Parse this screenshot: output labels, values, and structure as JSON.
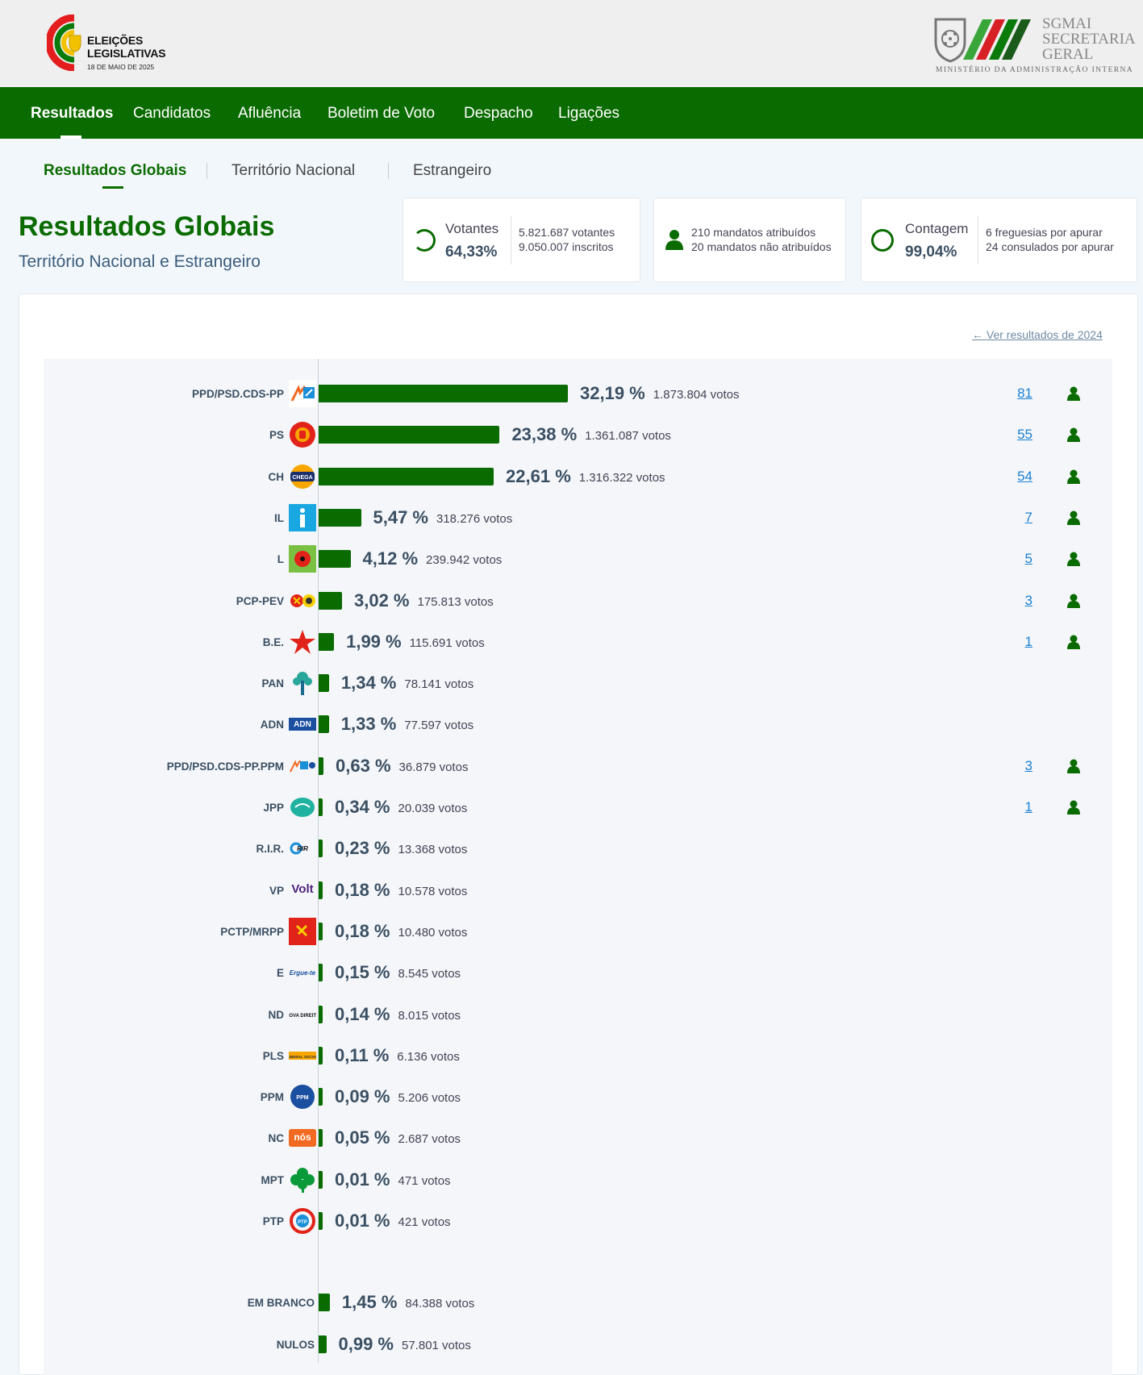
{
  "header": {
    "logo_line1": "ELEIÇÕES",
    "logo_line2": "LEGISLATIVAS",
    "logo_date": "18 DE MAIO DE 2025",
    "sgmai_line1": "SGMAI",
    "sgmai_line2": "SECRETARIA",
    "sgmai_line3": "GERAL",
    "ministry": "MINISTÉRIO DA ADMINISTRAÇÃO INTERNA"
  },
  "nav": {
    "items": [
      "Resultados",
      "Candidatos",
      "Afluência",
      "Boletim de Voto",
      "Despacho",
      "Ligações"
    ]
  },
  "subtabs": [
    "Resultados Globais",
    "Território Nacional",
    "Estrangeiro"
  ],
  "page": {
    "title": "Resultados Globais",
    "subtitle": "Território Nacional e Estrangeiro"
  },
  "stats": {
    "votantes_label": "Votantes",
    "votantes_pct": "64,33%",
    "votantes_line1": "5.821.687 votantes",
    "votantes_line2": "9.050.007 inscritos",
    "mandatos_line1": "210 mandatos atribuídos",
    "mandatos_line2": "20 mandatos não atribuídos",
    "contagem_label": "Contagem",
    "contagem_pct": "99,04%",
    "contagem_line1": "6 freguesias por apurar",
    "contagem_line2": "24 consulados por apurar"
  },
  "link_2024": "Ver resultados de 2024",
  "colors": {
    "brand_green": "#0a6b00",
    "link_blue": "#1a7fd4",
    "text_dark": "#3b4f63"
  },
  "chart_data": {
    "type": "bar",
    "orientation": "horizontal",
    "unit": "%",
    "categories": [
      "PPD/PSD.CDS-PP",
      "PS",
      "CH",
      "IL",
      "L",
      "PCP-PEV",
      "B.E.",
      "PAN",
      "ADN",
      "PPD/PSD.CDS-PP.PPM",
      "JPP",
      "R.I.R.",
      "VP",
      "PCTP/MRPP",
      "E",
      "ND",
      "PLS",
      "PPM",
      "NC",
      "MPT",
      "PTP",
      "EM BRANCO",
      "NULOS"
    ],
    "values": [
      32.19,
      23.38,
      22.61,
      5.47,
      4.12,
      3.02,
      1.99,
      1.34,
      1.33,
      0.63,
      0.34,
      0.23,
      0.18,
      0.18,
      0.15,
      0.14,
      0.11,
      0.09,
      0.05,
      0.01,
      0.01,
      1.45,
      0.99
    ],
    "pct_labels": [
      "32,19 %",
      "23,38 %",
      "22,61 %",
      "5,47 %",
      "4,12 %",
      "3,02 %",
      "1,99 %",
      "1,34 %",
      "1,33 %",
      "0,63 %",
      "0,34 %",
      "0,23 %",
      "0,18 %",
      "0,18 %",
      "0,15 %",
      "0,14 %",
      "0,11 %",
      "0,09 %",
      "0,05 %",
      "0,01 %",
      "0,01 %",
      "1,45 %",
      "0,99 %"
    ],
    "votes": [
      "1.873.804 votos",
      "1.361.087 votos",
      "1.316.322 votos",
      "318.276 votos",
      "239.942 votos",
      "175.813 votos",
      "115.691 votos",
      "78.141 votos",
      "77.597 votos",
      "36.879 votos",
      "20.039 votos",
      "13.368 votos",
      "10.578 votos",
      "10.480 votos",
      "8.545 votos",
      "8.015 votos",
      "6.136 votos",
      "5.206 votos",
      "2.687 votos",
      "471 votos",
      "421 votos",
      "84.388 votos",
      "57.801 votos"
    ],
    "seats": [
      "81",
      "55",
      "54",
      "7",
      "5",
      "3",
      "1",
      "",
      "",
      "3",
      "1",
      "",
      "",
      "",
      "",
      "",
      "",
      "",
      "",
      "",
      "",
      "",
      ""
    ],
    "icons": [
      "psd-cds-logo",
      "ps-fist-rose-logo",
      "chega-logo",
      "il-logo",
      "livre-poppy-logo",
      "cdu-logo",
      "be-star-logo",
      "pan-tree-logo",
      "adn-logo",
      "psd-cds-ppm-logo",
      "jpp-logo",
      "rir-logo",
      "volt-logo",
      "pctp-logo",
      "ergue-te-logo",
      "nova-direita-logo",
      "pls-logo",
      "ppm-logo",
      "nos-cidadaos-logo",
      "mpt-clover-logo",
      "ptp-logo",
      "",
      ""
    ],
    "icon_texts": [
      "",
      "",
      "CHEGA",
      "i",
      "",
      "",
      "",
      "",
      "ADN",
      "",
      "",
      "RIR",
      "Volt",
      "",
      "Ergue-te",
      "NOVA DIREITA",
      "LIBERAL SOCIAL",
      "PPM",
      "nós",
      "",
      "PTP",
      "",
      ""
    ]
  }
}
